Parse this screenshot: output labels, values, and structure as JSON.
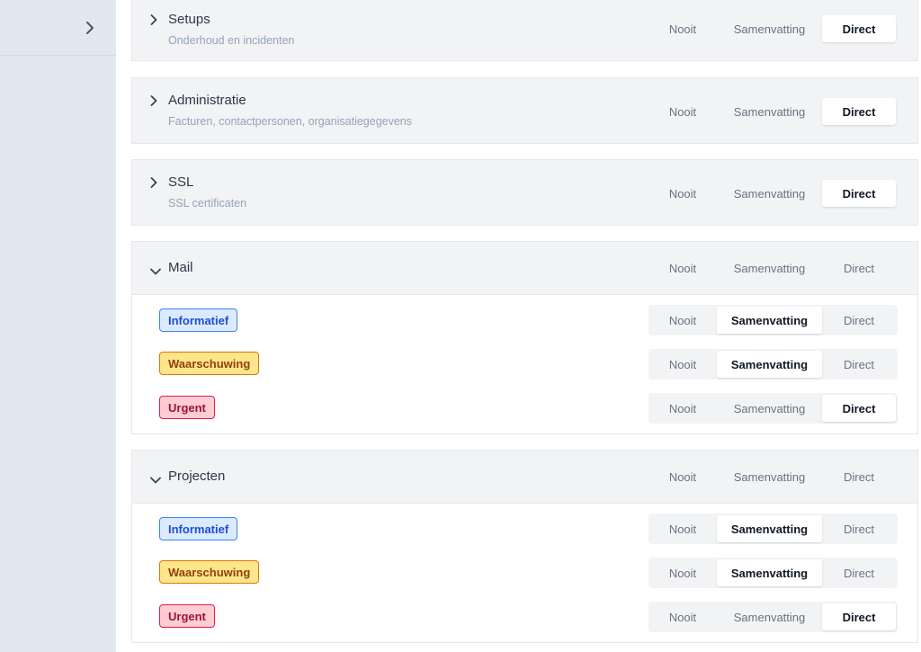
{
  "sidebar": {
    "expand_icon": "chevron-right-icon"
  },
  "option_labels": {
    "never": "Nooit",
    "summary": "Samenvatting",
    "direct": "Direct"
  },
  "sections": {
    "setups": {
      "title": "Setups",
      "subtitle": "Onderhoud en incidenten",
      "selected": "Direct"
    },
    "administratie": {
      "title": "Administratie",
      "subtitle": "Facturen, contactpersonen, organisatiegegevens",
      "selected": "Direct"
    },
    "ssl": {
      "title": "SSL",
      "subtitle": "SSL certificaten",
      "selected": "Direct"
    },
    "mail": {
      "title": "Mail",
      "rows": [
        {
          "label": "Informatief",
          "selected": "Samenvatting"
        },
        {
          "label": "Waarschuwing",
          "selected": "Samenvatting"
        },
        {
          "label": "Urgent",
          "selected": "Direct"
        }
      ]
    },
    "projecten": {
      "title": "Projecten",
      "rows": [
        {
          "label": "Informatief",
          "selected": "Samenvatting"
        },
        {
          "label": "Waarschuwing",
          "selected": "Samenvatting"
        },
        {
          "label": "Urgent",
          "selected": "Direct"
        }
      ]
    }
  },
  "colors": {
    "sidebar_bg": "#e2e8f0",
    "section_bg": "#f2f3f5",
    "info": "#3b82f6",
    "warning": "#d97706",
    "urgent": "#e11d48"
  }
}
